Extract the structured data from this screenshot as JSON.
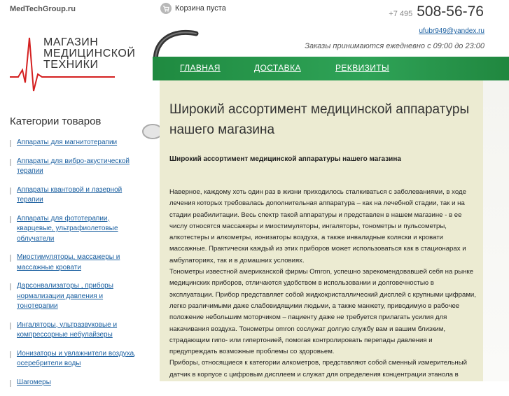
{
  "header": {
    "site_name": "MedTechGroup.ru",
    "logo_lines": [
      "МАГАЗИН",
      "МЕДИЦИНСКОЙ",
      "ТЕХНИКИ"
    ],
    "cart_label": "Корзина пуста",
    "phone_code": "+7 495",
    "phone_number": "508-56-76",
    "email": "ufubr949@yandex.ru",
    "hours": "Заказы принимаются ежедневно с 09:00 до 23:00"
  },
  "nav": {
    "items": [
      "ГЛАВНАЯ",
      "ДОСТАВКА",
      "РЕКВИЗИТЫ"
    ]
  },
  "sidebar": {
    "title": "Категории товаров",
    "items": [
      "Аппараты для магнитотерапии",
      "Аппараты для вибро-акустической терапии",
      "Аппараты квантовой и лазерной терапии",
      "Аппараты для фототерапии, кварцевые, ультрафиолетовые облучатели",
      "Миостимуляторы, массажеры и массажные кровати",
      "Дарсонвализаторы , приборы нормализации давления и тонотерапии",
      "Ингаляторы, ультразвуковые и компрессорные небулайзеры",
      "Ионизаторы и увлажнители воздуха, осеребрители воды",
      "Шагомеры"
    ]
  },
  "content": {
    "title": "Широкий ассортимент медицинской аппаратуры нашего магазина",
    "subtitle": "Широкий ассортимент медицинской аппаратуры нашего магазина",
    "paragraphs": [
      "Наверное, каждому хоть один раз в жизни приходилось сталкиваться с заболеваниями, в ходе лечения которых требовалась дополнительная аппаратура – как на лечебной стадии, так и на стадии реабилитации. Весь спектр такой аппаратуры и представлен в нашем магазине - в ее числу относятся массажеры и миостимуляторы, ингаляторы, тонометры и пульсометры, алкотестеры и алкометры, ионизаторы воздуха, а также инвалидные коляски и кровати массажные. Практически каждый из этих приборов может использоваться как в стационарах и амбулаториях, так и в домашних условиях.",
      "Тонометры известной американской фирмы Omron, успешно зарекомендовавшей себя на рынке медицинских приборов, отличаются удобством в использовании и долговечностью в эксплуатации. Прибор представляет собой жидкокристаллический дисплей с крупными цифрами, легко различимыми даже слабовидящими людьми, а также манжету, приводимую в рабочее положение небольшим моторчиком – пациенту даже не требуется прилагать усилия для накачивания воздуха. Тонометры omron сослужат долгую службу вам и вашим близким, страдающим гипо- или гипертонией, помогая контролировать перепады давления и предупреждать возможные проблемы со здоровьем.",
      "Приборы, относящиеся к категории алкометров, представляют собой сменный измерительный датчик в корпусе с цифровым дисплеем и служат для определения концентрации этанола в выдыхаемом воздухе. Кроме дорожно-транспортной экспертизы,"
    ]
  }
}
